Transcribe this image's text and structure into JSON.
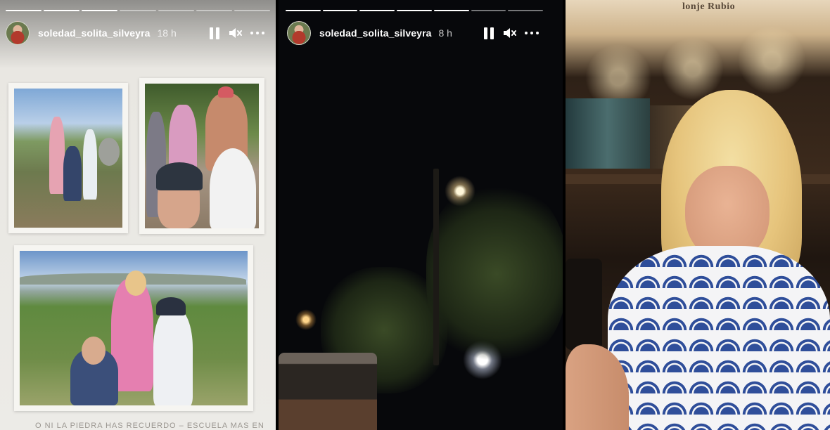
{
  "stories": [
    {
      "username": "soledad_solita_silveyra",
      "time": "18 h",
      "progress_total": 7,
      "progress_done": 3,
      "caption": "O NI LA PIEDRA HAS RECUERDO – ESCUELA MAS EN"
    },
    {
      "username": "soledad_solita_silveyra",
      "time": "8 h",
      "progress_total": 7,
      "progress_done": 5
    },
    {
      "sign_text": "lonje Rubio"
    }
  ],
  "icons": {
    "pause": "pause-icon",
    "mute": "volume-muted-icon",
    "more": "more-horizontal-icon"
  },
  "colors": {
    "progress_done": "#ffffff",
    "progress_remaining": "rgba(255,255,255,0.45)"
  }
}
